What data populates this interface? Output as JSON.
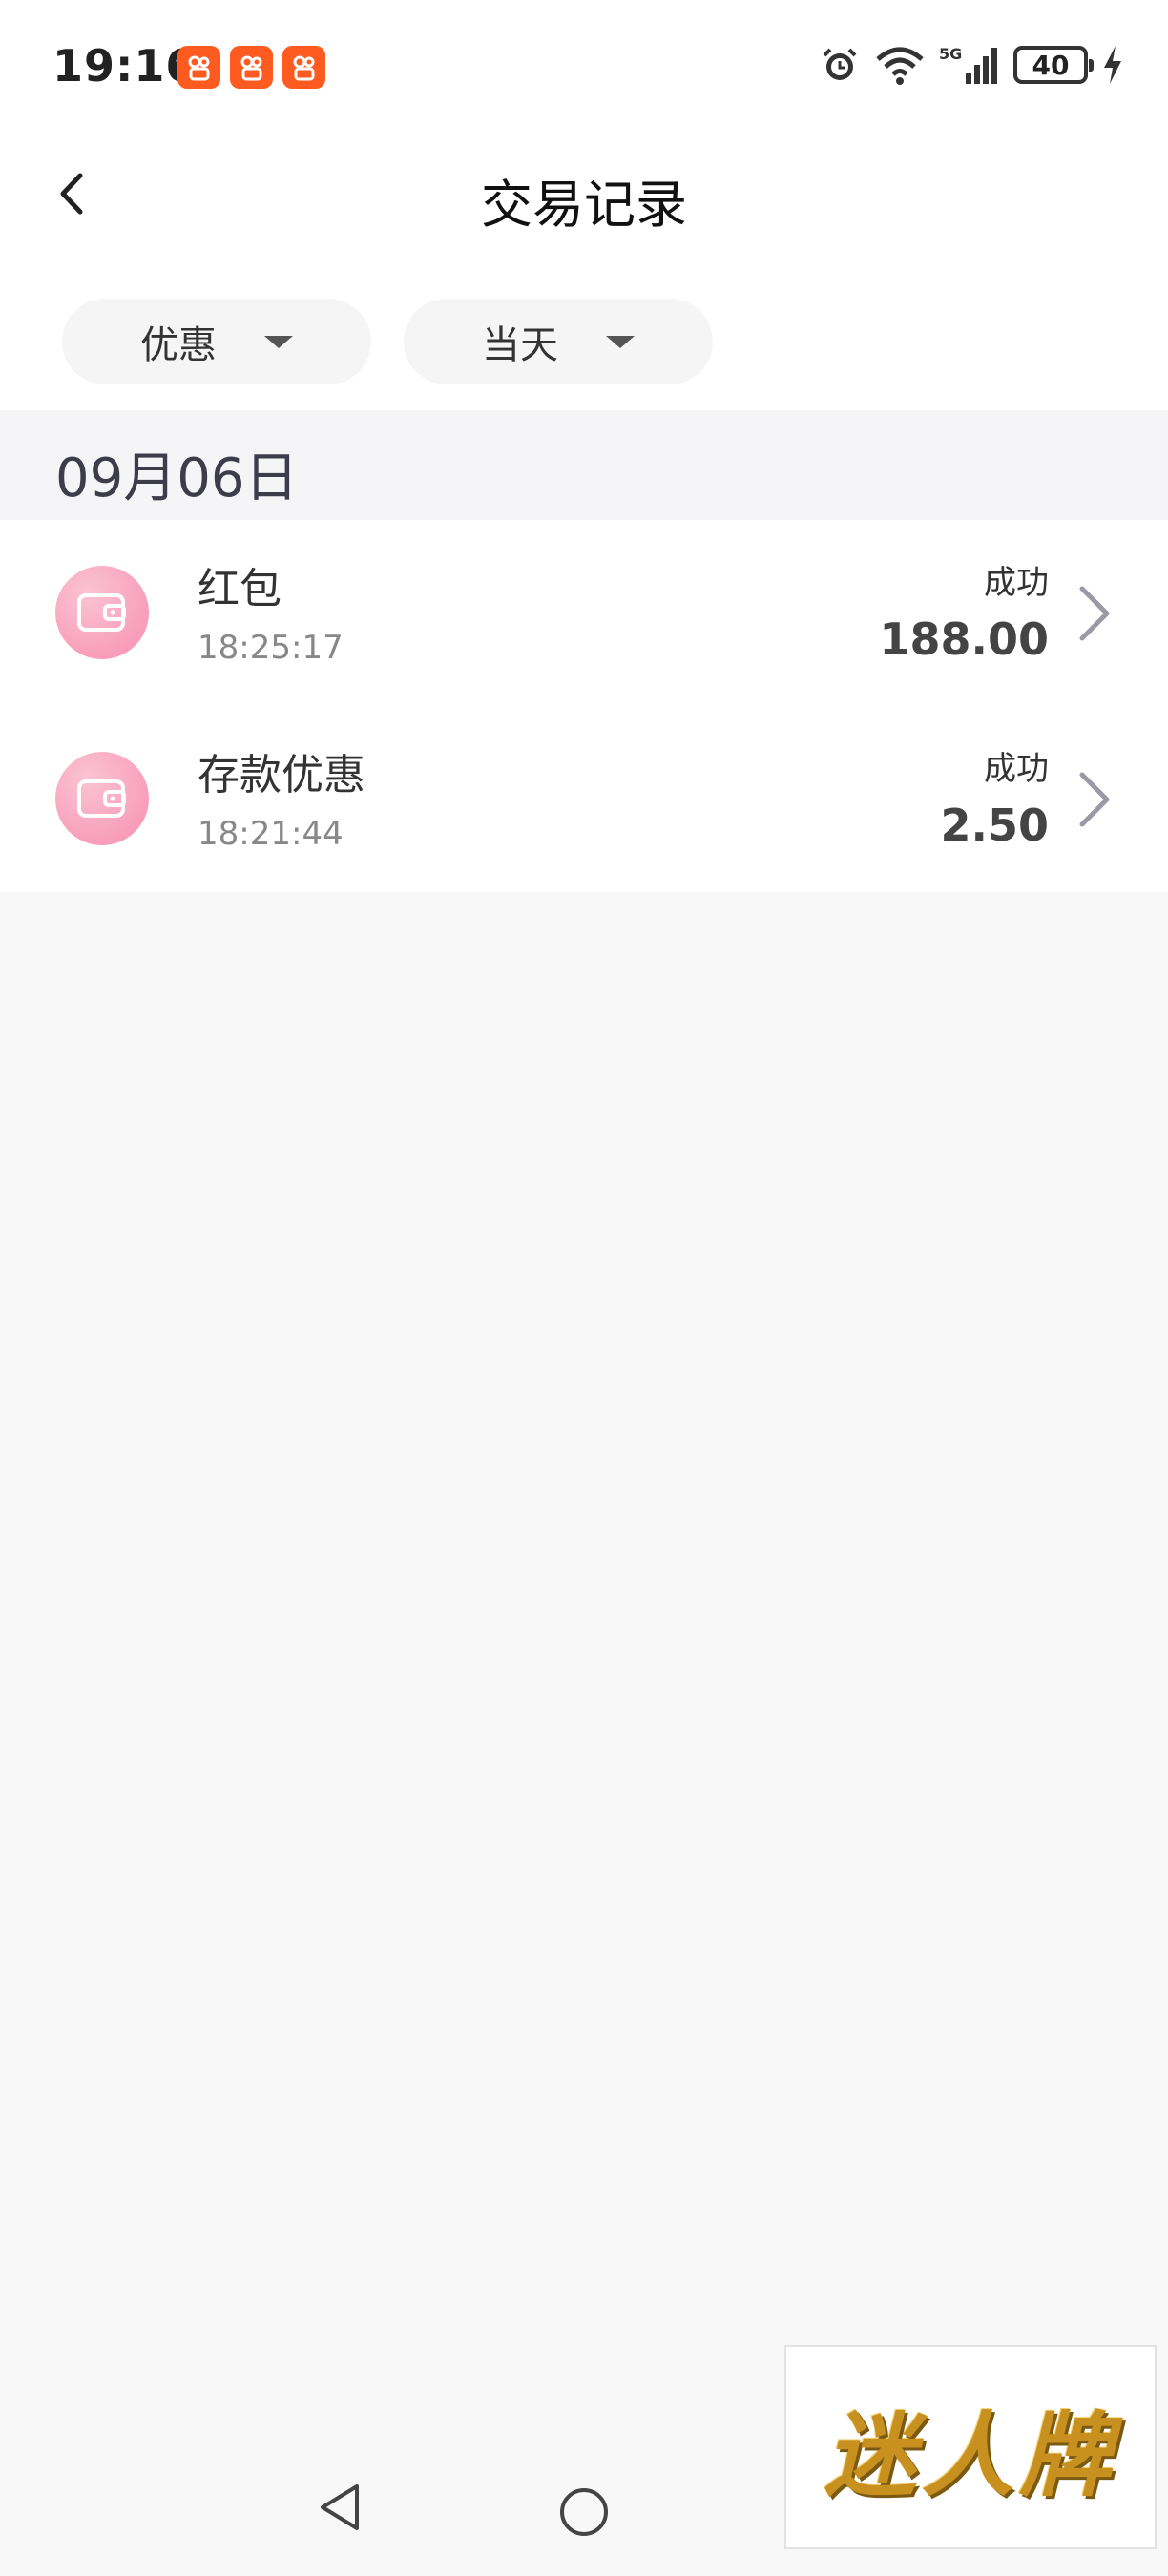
{
  "status_bar": {
    "time": "19:16",
    "app_badge_count": 3,
    "network": "5G",
    "battery": "40"
  },
  "header": {
    "title": "交易记录"
  },
  "filters": {
    "type_label": "优惠",
    "period_label": "当天"
  },
  "date_group": {
    "label": "09月06日"
  },
  "transactions": [
    {
      "name": "红包",
      "time": "18:25:17",
      "status": "成功",
      "amount": "188.00"
    },
    {
      "name": "存款优惠",
      "time": "18:21:44",
      "status": "成功",
      "amount": "2.50"
    }
  ],
  "watermark": {
    "text": "迷人牌"
  },
  "colors": {
    "icon_pink": "#f78fb0",
    "badge_orange": "#ff5a1f",
    "background": "#f8f8f8"
  }
}
